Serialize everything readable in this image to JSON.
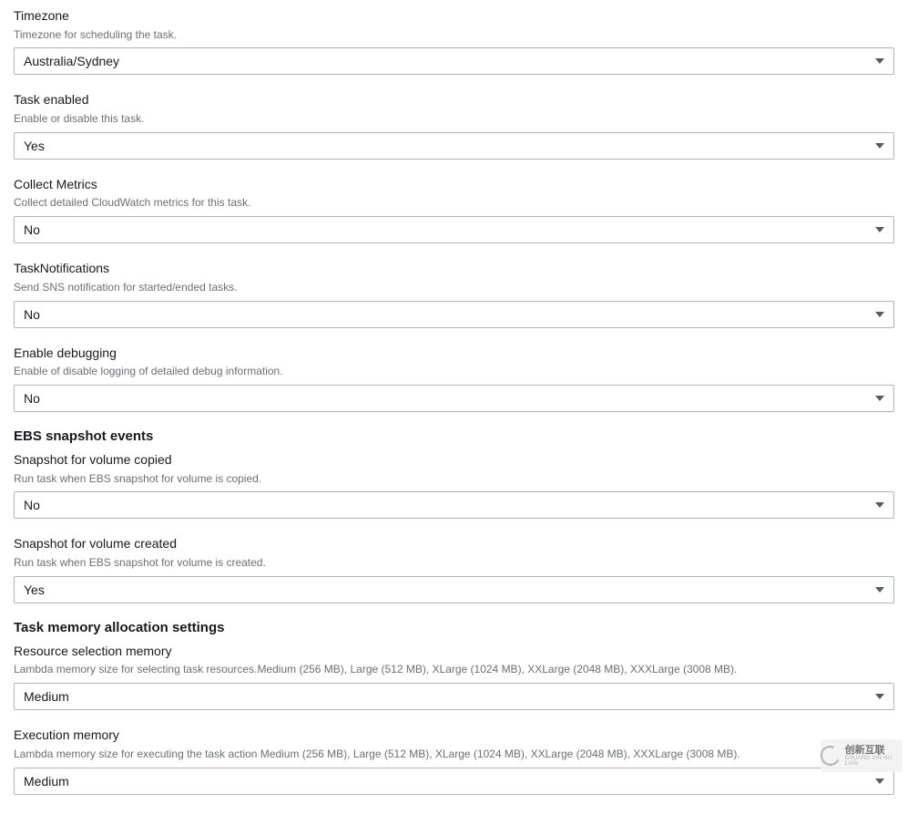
{
  "fields": {
    "timezone": {
      "label": "Timezone",
      "desc": "Timezone for scheduling the task.",
      "value": "Australia/Sydney"
    },
    "task_enabled": {
      "label": "Task enabled",
      "desc": "Enable or disable this task.",
      "value": "Yes"
    },
    "collect_metrics": {
      "label": "Collect Metrics",
      "desc": "Collect detailed CloudWatch metrics for this task.",
      "value": "No"
    },
    "task_notifications": {
      "label": "TaskNotifications",
      "desc": "Send SNS notification for started/ended tasks.",
      "value": "No"
    },
    "enable_debugging": {
      "label": "Enable debugging",
      "desc": "Enable of disable logging of detailed debug information.",
      "value": "No"
    }
  },
  "ebs_section": {
    "title": "EBS snapshot events",
    "snapshot_copied": {
      "label": "Snapshot for volume copied",
      "desc": "Run task when EBS snapshot for volume is copied.",
      "value": "No"
    },
    "snapshot_created": {
      "label": "Snapshot for volume created",
      "desc": "Run task when EBS snapshot for volume is created.",
      "value": "Yes"
    }
  },
  "memory_section": {
    "title": "Task memory allocation settings",
    "resource_selection": {
      "label": "Resource selection memory",
      "desc": "Lambda memory size for selecting task resources.Medium (256 MB), Large (512 MB), XLarge (1024 MB), XXLarge (2048 MB), XXXLarge (3008 MB).",
      "value": "Medium"
    },
    "execution": {
      "label": "Execution memory",
      "desc": "Lambda memory size for executing the task action Medium (256 MB), Large (512 MB), XLarge (1024 MB), XXLarge (2048 MB), XXXLarge (3008 MB).",
      "value": "Medium"
    }
  },
  "watermark": {
    "cn": "创新互联",
    "en": "CHUANG XIN HU LIAN"
  }
}
